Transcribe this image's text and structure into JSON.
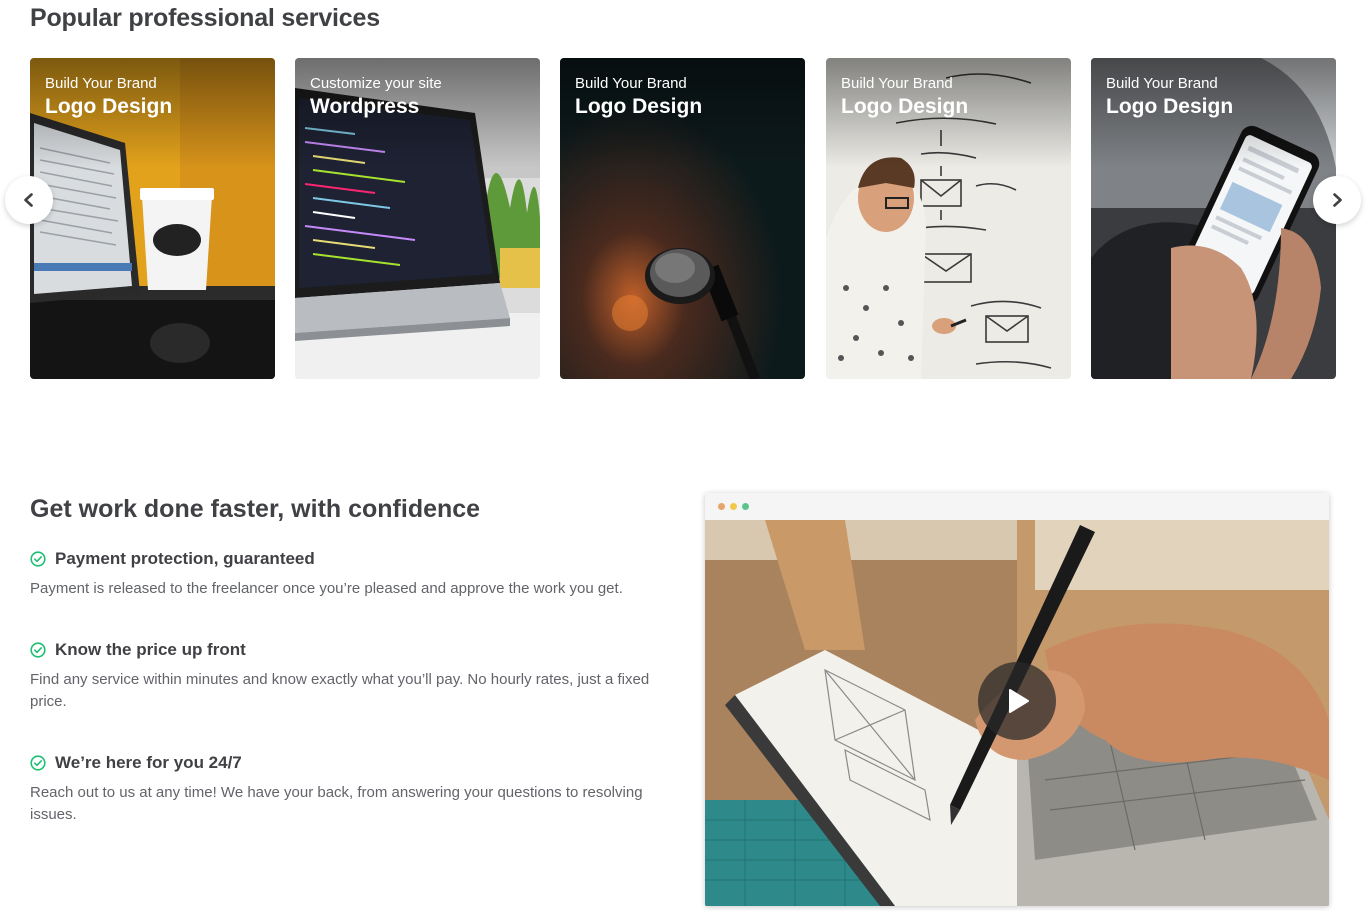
{
  "popular": {
    "title": "Popular professional services",
    "cards": [
      {
        "subtitle": "Build Your Brand",
        "title": "Logo Design",
        "image": "laptop-coffee-cup-photo"
      },
      {
        "subtitle": "Customize your site",
        "title": "Wordpress",
        "image": "laptop-code-photo"
      },
      {
        "subtitle": "Build Your Brand",
        "title": "Logo Design",
        "image": "microphone-photo"
      },
      {
        "subtitle": "Build Your Brand",
        "title": "Logo Design",
        "image": "whiteboard-man-photo"
      },
      {
        "subtitle": "Build Your Brand",
        "title": "Logo Design",
        "image": "phone-hands-photo"
      }
    ],
    "prev_icon": "chevron-left-icon",
    "next_icon": "chevron-right-icon"
  },
  "why": {
    "title": "Get work done faster, with confidence",
    "features": [
      {
        "title": "Payment protection, guaranteed",
        "desc": "Payment is released to the freelancer once you’re pleased and approve the work you get."
      },
      {
        "title": "Know the price up front",
        "desc": "Find any service within minutes and know exactly what you’ll pay. No hourly rates, just a fixed price."
      },
      {
        "title": "We’re here for you 24/7",
        "desc": "Reach out to us at any time! We have your back, from answering your questions to resolving issues."
      }
    ],
    "check_icon": "check-circle-icon",
    "check_color": "#1dbf73"
  },
  "video": {
    "image": "sketching-notebook-tablet-photo",
    "play_icon": "play-icon",
    "window_dots": [
      "#e5a66b",
      "#f0c94a",
      "#5dc38d"
    ]
  }
}
